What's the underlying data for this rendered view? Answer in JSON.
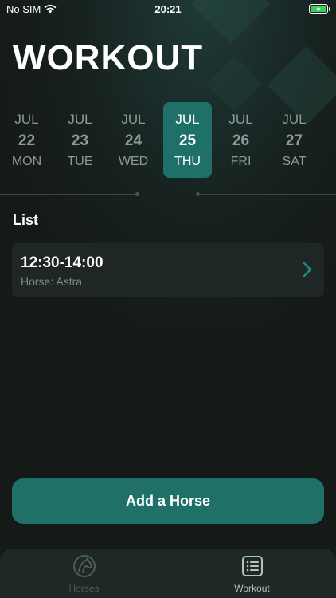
{
  "status_bar": {
    "carrier": "No SIM",
    "time": "20:21"
  },
  "page_title": "WORKOUT",
  "week": [
    {
      "month": "JUL",
      "date": "22",
      "weekday": "MON",
      "selected": false
    },
    {
      "month": "JUL",
      "date": "23",
      "weekday": "TUE",
      "selected": false
    },
    {
      "month": "JUL",
      "date": "24",
      "weekday": "WED",
      "selected": false
    },
    {
      "month": "JUL",
      "date": "25",
      "weekday": "THU",
      "selected": true
    },
    {
      "month": "JUL",
      "date": "26",
      "weekday": "FRI",
      "selected": false
    },
    {
      "month": "JUL",
      "date": "27",
      "weekday": "SAT",
      "selected": false
    }
  ],
  "list": {
    "title": "List",
    "items": [
      {
        "time": "12:30-14:00",
        "horse": "Horse: Astra"
      }
    ]
  },
  "add_button_label": "Add a Horse",
  "tabs": [
    {
      "label": "Horses",
      "icon": "horse-icon",
      "active": false
    },
    {
      "label": "Workout",
      "icon": "list-icon",
      "active": true
    }
  ],
  "colors": {
    "background": "#151a19",
    "accent": "#1e7068",
    "card": "#1f2726",
    "muted_text": "#8d9a97"
  }
}
